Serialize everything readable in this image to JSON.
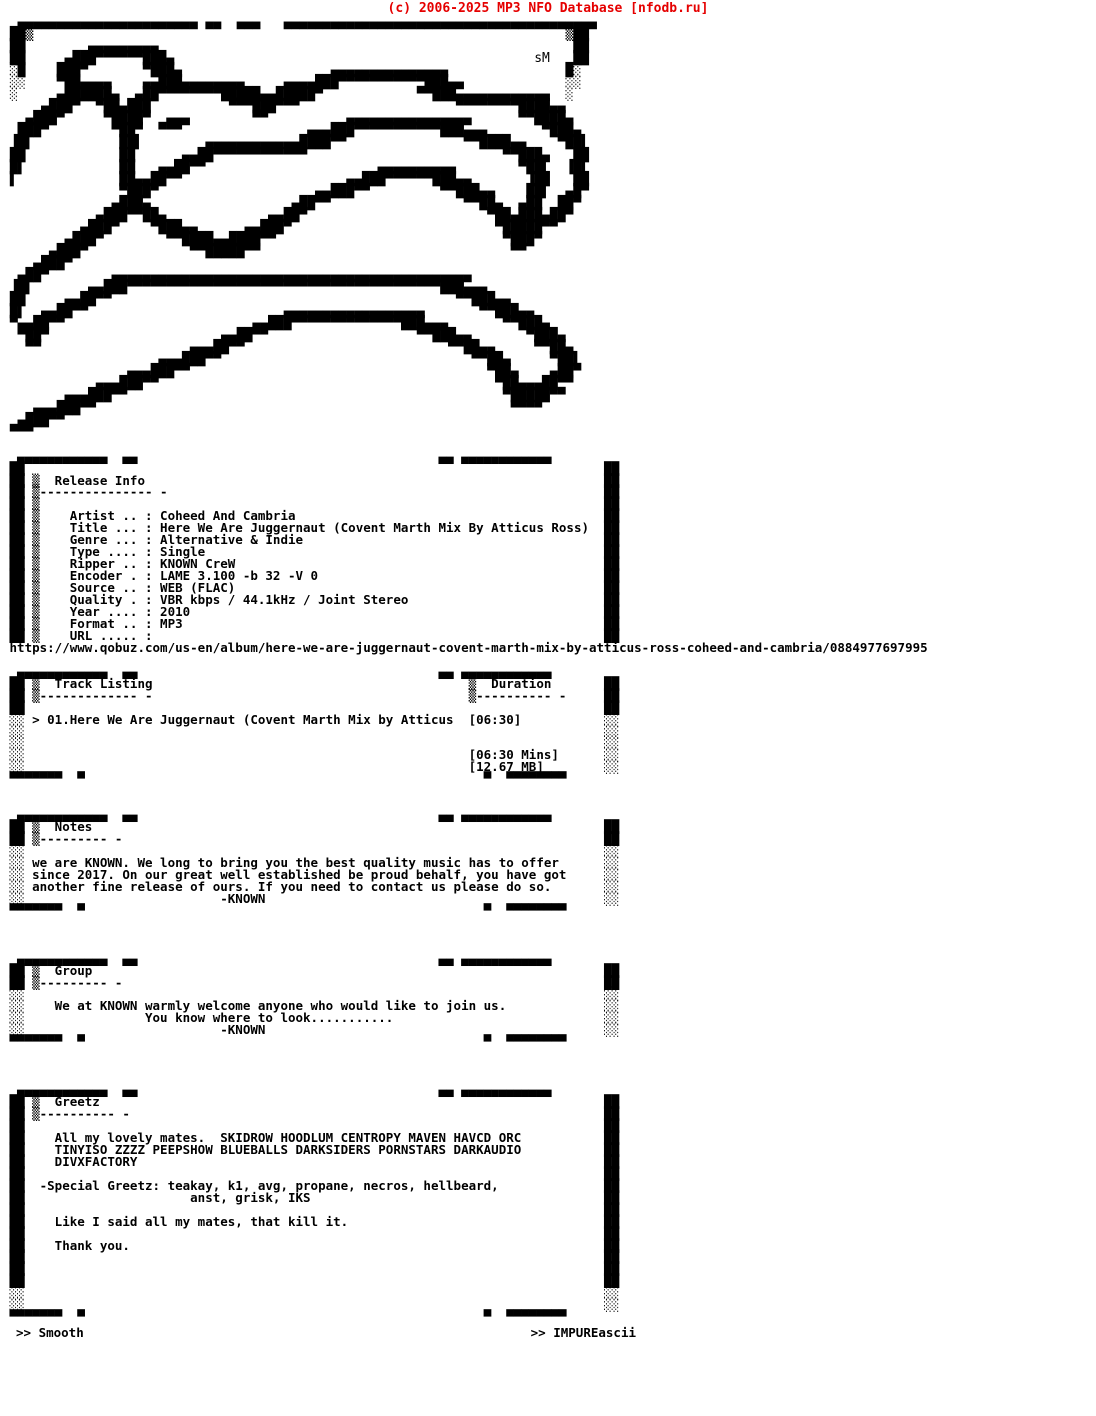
{
  "site": {
    "credit": "(c) 2006-2025 MP3 NFO Database [nfodb.ru]",
    "credit_color": "#e50000"
  },
  "logo": {
    "group_name": "KNOWN",
    "artist_signature": "sM",
    "style": "ascii-block-graffiti",
    "art": [
      "  ▄▄▄▄▄▄▄▄▄▄▄▄▄▄▄▄▄▄▄▄▄▄▄ ▄▄  ▄▄▄   ▄▄▄▄▄▄▄▄▄▄▄▄▄▄▄▄▄▄▄▄▄▄▄▄▄▄▄▄▄▄▄▄▄▄▄▄▄▄▄▄ ",
      " ██▒                                                                    ▒██ ",
      " ██        ▄▄▄▄▄▄▄▄▄                                                     ██ ",
      " ██     ▄███▀▀▀▀▀▀███▄                                              sM   ██ ",
      " ░█    ███▀       ▀███▄                   ▄▄▄▄▄▄▄▄▄▄▄▄▄▄▄               █░ ",
      " ░░    ▀██▄▄▄▄    ▄▄███▄▄▄▄▄▄▄▄     ▄▄▄▄███▀▀▀▀▀▀▀▀▀▀▀███▄▄             ░░ ",
      " ░     ▄██████▄  ▄██▀▀▀▀▀▀▀▀█████▄▄█████▀            ▀▀███▄▄▄▄▄▄▄▄▄▄▄▄  ░  ",
      "     ▄███▀  ▀██▄███          ▀▀▀███▀▀▀                    ▀▀▀▀▀▀▀▀████▄▄   ",
      "   ▄███▀     ▀████▀  ▄▄▄        ▀▀          ▄▄▄▄▄▄▄▄▄▄▄▄▄▄▄▄      ▀▀████▄  ",
      "  ███▀        ▀██▀  ▀▀▀                ▄▄▄███▀▀▀▀▀▀▀▀▀▀▀███▄▄▄       ▀███▄ ",
      " ▐█▌           ██▌        ▄▄▄▄▄▄▄▄▄▄▄▄████▀▀               ▀▀████▄▄    ▀██▌",
      " ██            ██      ▄▄██▀▀▀▀▀▀▀▀▀▀▀▀                         ▀▀███▄   ██",
      " █▌            ██   ▄▄██▀▀                      ▄▄▄▄▄▄▄▄▄▄        ▀██▌  ▐█▌",
      " ▌             ██▄▄██▀▀                     ▄▄███▀▀▀▀▀▀███▄▄       ▐██   ██",
      "               ▀███▀                    ▄▄███▀▀         ▀▀███▄▄    ██▌  ▄█▀",
      "              ▄███▄                  ▄██▀▀                 ▀▀██▄  ▄██  ██▀ ",
      "            ▄███▀▀██▄             ▄▄██▀                       ▀██▄███▄██▀  ",
      "          ▄███▀    ▀███▄▄      ▄▄███▀                          ▀█████▀▀    ",
      "        ▄███▀        ▀▀████▄▄████▀▀                             ▀███▀      ",
      "      ▄███▀             ▀▀█████▀▀                                ▀▀        ",
      "    ▄███▀                                                                  ",
      "  ▄██▀        ▄▄▄▄▄▄▄▄▄▄▄▄▄▄▄▄▄▄▄▄▄▄▄▄▄▄▄▄▄▄▄▄▄▄▄▄▄▄▄▄▄▄▄▄▄▄              ",
      " ▐█▌       ▄▄███▀▀▀▀▀▀▀▀▀▀▀▀▀▀▀▀▀▀▀▀▀▀▀▀▀▀▀▀▀▀▀▀▀▀▀▀▀▀▀▀███▄▄▄            ",
      " ██     ▄▄██▀▀                                            ▀▀███▄▄         ",
      " █▌  ▄▄██▀▀                         ▄▄▄▄▄▄▄▄▄▄▄▄▄▄▄▄▄▄       ▀▀███▄▄      ",
      " ▀▄▄██▀▀                        ▄▄███▀▀▀▀▀▀▀▀▀▀▀▀▀▀███▄▄▄       ▀▀███▄    ",
      "  ▀██▀                      ▄▄██▀▀                   ▀▀███▄▄       ▀███▄  ",
      "   ▀▀                   ▄▄▄██▀▀                          ▀▀██▄▄     ▀▀██▄ ",
      "                    ▄▄▄███▀▀                                ▀▀██▄     ▀██▌",
      "                ▄▄▄███▀▀                                      ▀██▄    ▄██▀",
      "            ▄▄▄███▀▀                                           ▀██▄▄▄██▀▀ ",
      "        ▄▄▄███▀▀                                                ▀█████▀▀  ",
      "    ▄▄▄███▀▀                                                     ▀▀▀▀      ",
      "  ▄███▀▀                                                                   ",
      " ▀▀▀                                                                       "
    ]
  },
  "sections": [
    {
      "id": "release-info",
      "title": "Release Info",
      "underline": "--------------- -",
      "fields": [
        {
          "label": "Artist .. :",
          "value": "Coheed And Cambria"
        },
        {
          "label": "Title ... :",
          "value": "Here We Are Juggernaut (Covent Marth Mix By Atticus Ross)"
        },
        {
          "label": "Genre ... :",
          "value": "Alternative & Indie"
        },
        {
          "label": "Type .... :",
          "value": "Single"
        },
        {
          "label": "Ripper .. :",
          "value": "KNOWN CreW"
        },
        {
          "label": "Encoder . :",
          "value": "LAME 3.100 -b 32 -V 0"
        },
        {
          "label": "Source .. :",
          "value": "WEB (FLAC)"
        },
        {
          "label": "Quality . :",
          "value": "VBR kbps / 44.1kHz / Joint Stereo"
        },
        {
          "label": "Year .... :",
          "value": "2010"
        },
        {
          "label": "Format .. :",
          "value": "MP3"
        },
        {
          "label": "URL ..... :",
          "value": ""
        }
      ],
      "url": "https://www.qobuz.com/us-en/album/here-we-are-juggernaut-covent-marth-mix-by-atticus-ross-coheed-and-cambria/0884977697995"
    },
    {
      "id": "track-listing",
      "title": "Track Listing",
      "underline": "------------- -",
      "duration_title": "Duration",
      "duration_underline": "---------- -",
      "tracks": [
        {
          "marker": ">",
          "number": "01.",
          "name": "Here We Are Juggernaut (Covent Marth Mix by Atticus",
          "duration": "[06:30]"
        }
      ],
      "total_time": "[06:30 Mins]",
      "total_size": "[12.67 MB]"
    },
    {
      "id": "notes",
      "title": "Notes",
      "underline": "--------- -",
      "lines": [
        "we are KNOWN. We long to bring you the best quality music has to offer",
        "since 2017. On our great well established be proud behalf, you have got",
        "another fine release of ours. If you need to contact us please do so.",
        "                         -KNOWN"
      ]
    },
    {
      "id": "group",
      "title": "Group",
      "underline": "--------- -",
      "lines": [
        "   We at KNOWN warmly welcome anyone who would like to join us.",
        "               You know where to look...........",
        "                         -KNOWN"
      ]
    },
    {
      "id": "greetz",
      "title": "Greetz",
      "underline": "---------- -",
      "lines": [
        "   All my lovely mates.  SKIDROW HOODLUM CENTROPY MAVEN HAVCD ORC",
        "   TINYISO ZZZZ PEEPSHOW BLUEBALLS DARKSIDERS PORNSTARS DARKAUDIO",
        "   DIVXFACTORY",
        "",
        " -Special Greetz: teakay, k1, avg, propane, necros, hellbeard,",
        "                     anst, grisk, IKS",
        "",
        "   Like I said all my mates, that kill it.",
        "",
        "   Thank you."
      ]
    }
  ],
  "footer": {
    "left": ">> Smooth",
    "right": ">> IMPUREascii"
  }
}
